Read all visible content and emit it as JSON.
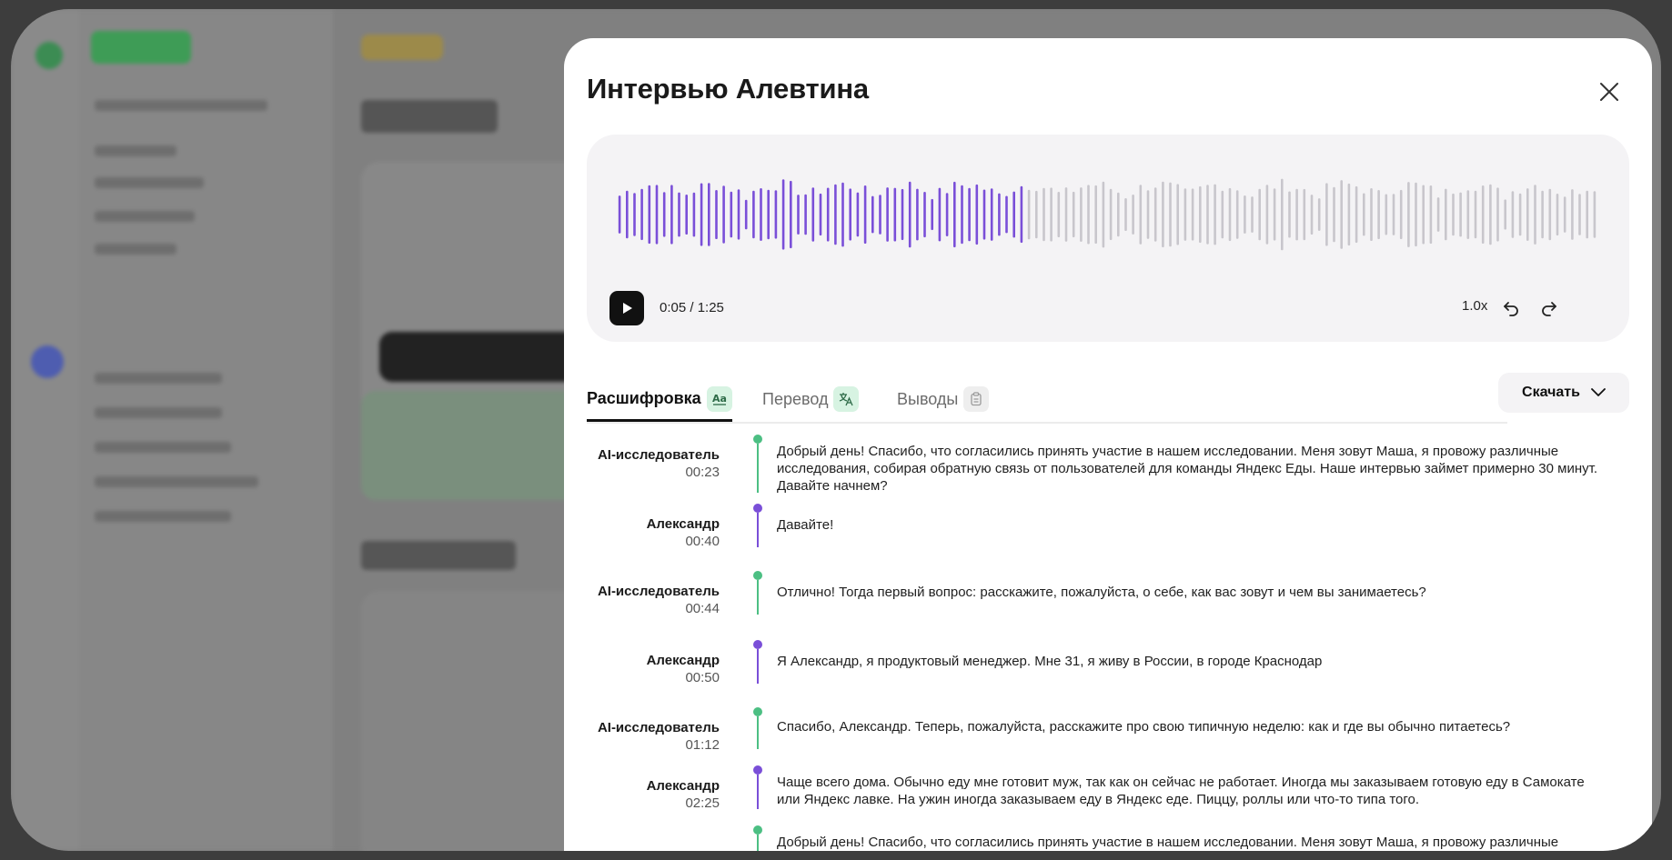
{
  "modal": {
    "title": "Интервью Алевтина"
  },
  "player": {
    "time": "0:05 / 1:25",
    "speed": "1.0x",
    "progress_fraction": 0.415,
    "colors": {
      "played": "#7a4fd8",
      "unplayed": "#c8c6cc"
    }
  },
  "tabs": [
    {
      "label": "Расшифровка",
      "icon": "text-format-icon",
      "active": true
    },
    {
      "label": "Перевод",
      "icon": "translate-icon",
      "active": false
    },
    {
      "label": "Выводы",
      "icon": "clipboard-icon",
      "active": false
    }
  ],
  "download": {
    "label": "Скачать"
  },
  "transcript": [
    {
      "speaker": "AI-исследователь",
      "time": "00:23",
      "role": "ai",
      "text": "Добрый день! Спасибо, что согласились принять участие в нашем исследовании. Меня зовут Маша, я провожу различные исследования, собирая обратную связь от пользователей для команды Яндекс Еды. Наше интервью займет примерно 30 минут. Давайте начнем?"
    },
    {
      "speaker": "Александр",
      "time": "00:40",
      "role": "user",
      "text": "Давайте!"
    },
    {
      "speaker": "AI-исследователь",
      "time": "00:44",
      "role": "ai",
      "text": "Отлично! Тогда первый вопрос: расскажите, пожалуйста, о себе, как вас зовут и чем вы занимаетесь?"
    },
    {
      "speaker": "Александр",
      "time": "00:50",
      "role": "user",
      "text": "Я Александр, я продуктовый менеджер. Мне 31, я живу в России, в городе Краснодар"
    },
    {
      "speaker": "AI-исследователь",
      "time": "01:12",
      "role": "ai",
      "text": "Спасибо, Александр. Теперь, пожалуйста, расскажите про свою типичную неделю: как и где вы обычно питаетесь?"
    },
    {
      "speaker": "Александр",
      "time": "02:25",
      "role": "user",
      "text": "Чаще всего дома. Обычно еду мне готовит муж, так как он сейчас не работает. Иногда мы заказываем готовую еду в Самокате или Яндекс лавке. На ужин иногда заказываем еду в Яндекс еде. Пиццу, роллы или что-то типа того."
    },
    {
      "speaker": "",
      "time": "",
      "role": "ai",
      "text": "Добрый день! Спасибо, что согласились принять участие в нашем исследовании. Меня зовут Маша, я провожу различные"
    }
  ]
}
